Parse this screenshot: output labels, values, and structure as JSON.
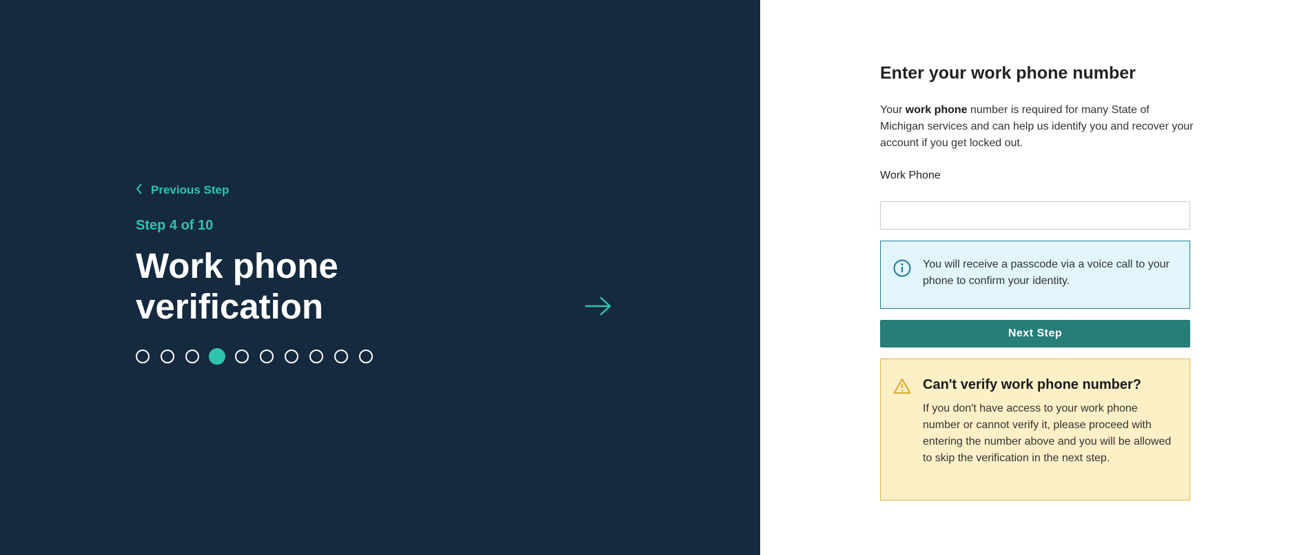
{
  "left_panel": {
    "previous_step_label": "Previous Step",
    "step_counter": "Step 4 of 10",
    "title": "Work phone verification",
    "steps_total": 10,
    "current_step": 4
  },
  "form": {
    "heading": "Enter your work phone number",
    "description_prefix": "Your ",
    "description_bold": "work phone",
    "description_suffix": " number is required for many State of Michigan services and can help us identify you and recover your account if you get locked out.",
    "phone_label": "Work Phone",
    "phone_value": "",
    "info_text": "You will receive a passcode via a voice call to your phone to confirm your identity.",
    "next_button_label": "Next Step",
    "warning_title": "Can't verify work phone number?",
    "warning_text": "If you don't have access to your work phone number or cannot verify it, please proceed with entering the number above and you will be allowed to skip the verification in the next step."
  },
  "colors": {
    "left_background": "#152a3e",
    "accent_teal": "#2ec4b0",
    "button_teal": "#277d78",
    "info_background": "#e1f5fb",
    "warning_background": "#fdefc6"
  },
  "icons": {
    "back": "chevron-left-icon",
    "forward": "arrow-right-icon",
    "info": "info-circle-icon",
    "warning": "warning-triangle-icon"
  }
}
